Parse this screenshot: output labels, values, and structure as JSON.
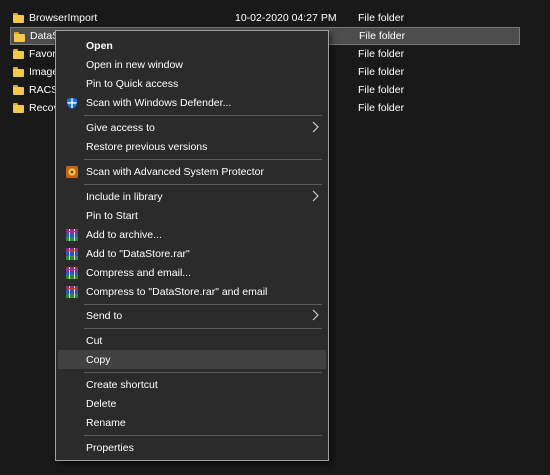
{
  "files": [
    {
      "name": "BrowserImport",
      "date": "10-02-2020 04:27 PM",
      "type": "File folder"
    },
    {
      "name": "DataS",
      "date": "",
      "type": "File folder"
    },
    {
      "name": "Favori",
      "date": "",
      "type": "File folder"
    },
    {
      "name": "Image",
      "date": "",
      "type": "File folder"
    },
    {
      "name": "RACSI",
      "date": "",
      "type": "File folder"
    },
    {
      "name": "Recov",
      "date": "",
      "type": "File folder"
    }
  ],
  "context_menu": {
    "open": "Open",
    "open_new_window": "Open in new window",
    "pin_quick_access": "Pin to Quick access",
    "scan_defender": "Scan with Windows Defender...",
    "give_access": "Give access to",
    "restore_previous": "Restore previous versions",
    "scan_asp": "Scan with Advanced System Protector",
    "include_library": "Include in library",
    "pin_start": "Pin to Start",
    "add_archive": "Add to archive...",
    "add_rar": "Add to \"DataStore.rar\"",
    "compress_email": "Compress and email...",
    "compress_rar_email": "Compress to \"DataStore.rar\" and email",
    "send_to": "Send to",
    "cut": "Cut",
    "copy": "Copy",
    "create_shortcut": "Create shortcut",
    "delete": "Delete",
    "rename": "Rename",
    "properties": "Properties"
  },
  "icons": {
    "defender": "shield-icon",
    "asp": "advanced-system-protector-icon",
    "winrar": "winrar-icon",
    "submenu": "chevron-right-icon",
    "folder": "folder-icon"
  }
}
